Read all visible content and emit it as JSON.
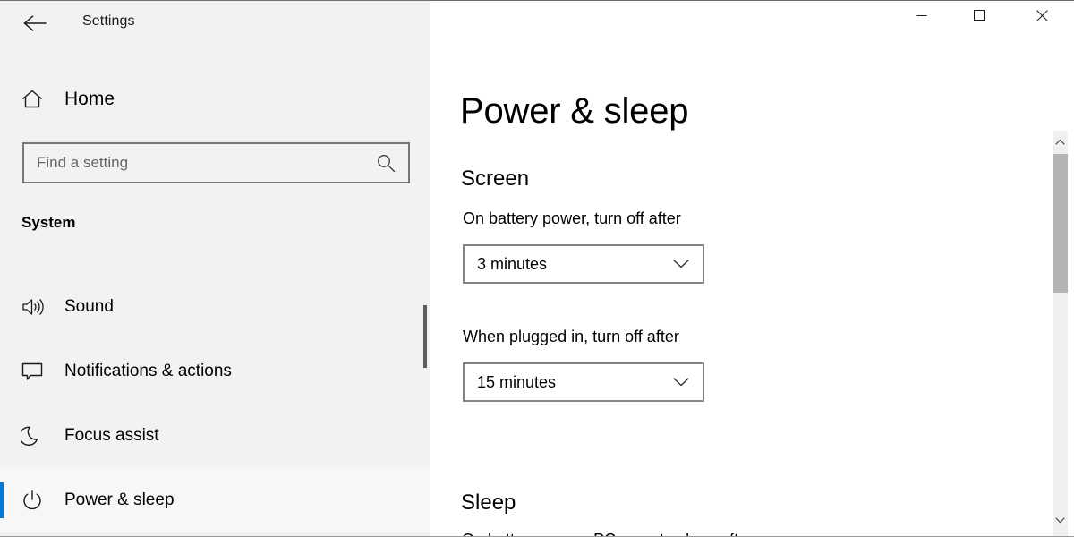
{
  "window": {
    "app_title": "Settings",
    "back_icon": "back-arrow-icon",
    "controls": {
      "minimize_label": "Minimize",
      "maximize_label": "Maximize",
      "close_label": "Close"
    }
  },
  "sidebar": {
    "home": {
      "label": "Home",
      "icon": "home-icon"
    },
    "search": {
      "placeholder": "Find a setting",
      "value": "",
      "icon": "search-icon"
    },
    "section_label": "System",
    "items": [
      {
        "label": "Sound",
        "icon": "speaker-icon",
        "selected": false
      },
      {
        "label": "Notifications & actions",
        "icon": "chat-bubble-icon",
        "selected": false
      },
      {
        "label": "Focus assist",
        "icon": "crescent-moon-icon",
        "selected": false
      },
      {
        "label": "Power & sleep",
        "icon": "power-icon",
        "selected": true
      }
    ],
    "accent_color": "#0078d7",
    "background_color": "#f2f2f2"
  },
  "main": {
    "page_title": "Power & sleep",
    "sections": [
      {
        "heading": "Screen",
        "fields": [
          {
            "label": "On battery power, turn off after",
            "selected_option": "3 minutes",
            "chevron_icon": "chevron-down-icon"
          },
          {
            "label": "When plugged in, turn off after",
            "selected_option": "15 minutes",
            "chevron_icon": "chevron-down-icon"
          }
        ]
      },
      {
        "heading": "Sleep",
        "fields": []
      }
    ],
    "cutoff_text": "On battery power, PC goes to sleep after"
  },
  "scrollbars": {
    "content": {
      "up_icon": "chevron-up-icon",
      "down_icon": "chevron-down-icon",
      "thumb_color": "#b4b4b4",
      "track_color": "#f0f0f0"
    },
    "sidebar": {
      "thumb_color": "#5d5d5d"
    }
  }
}
